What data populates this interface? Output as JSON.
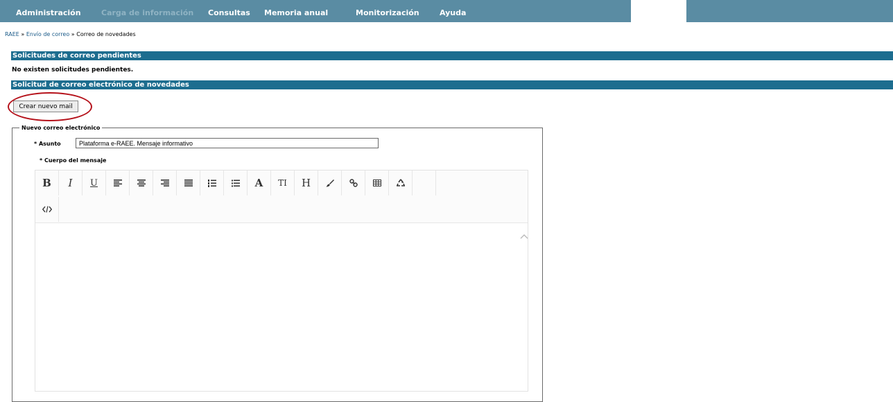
{
  "nav": {
    "items": [
      {
        "label": "Administración",
        "disabled": false
      },
      {
        "label": "Carga de información",
        "disabled": true
      },
      {
        "label": "Consultas",
        "disabled": false
      },
      {
        "label": "Memoria anual",
        "disabled": false
      },
      {
        "label": "Monitorización",
        "disabled": false
      },
      {
        "label": "Ayuda",
        "disabled": false
      }
    ]
  },
  "breadcrumb": {
    "root": "RAEE",
    "sep1": " » ",
    "parent": "Envío de correo",
    "sep2": " » ",
    "current": "Correo de novedades"
  },
  "pending": {
    "header": "Solicitudes de correo pendientes",
    "empty_text": "No existen solicitudes pendientes."
  },
  "request": {
    "header": "Solicitud de correo electrónico de novedades",
    "create_button": "Crear nuevo mail"
  },
  "form": {
    "legend": "Nuevo correo electrónico",
    "subject_label": "* Asunto",
    "subject_value": "Plataforma e-RAEE. Mensaje informativo",
    "body_label": "* Cuerpo del mensaje"
  },
  "editor": {
    "toolbar": [
      {
        "icon": "bold-icon",
        "glyph": "B"
      },
      {
        "icon": "italic-icon",
        "glyph": "I"
      },
      {
        "icon": "underline-icon",
        "glyph": "U"
      },
      {
        "icon": "align-left-icon",
        "glyph": ""
      },
      {
        "icon": "align-center-icon",
        "glyph": ""
      },
      {
        "icon": "align-right-icon",
        "glyph": ""
      },
      {
        "icon": "align-justify-icon",
        "glyph": ""
      },
      {
        "icon": "ordered-list-icon",
        "glyph": ""
      },
      {
        "icon": "unordered-list-icon",
        "glyph": ""
      },
      {
        "icon": "font-color-icon",
        "glyph": "A"
      },
      {
        "icon": "font-size-icon",
        "glyph": "TI"
      },
      {
        "icon": "heading-icon",
        "glyph": "H"
      },
      {
        "icon": "brush-icon",
        "glyph": ""
      },
      {
        "icon": "link-icon",
        "glyph": ""
      },
      {
        "icon": "table-icon",
        "glyph": ""
      },
      {
        "icon": "recycle-icon",
        "glyph": ""
      },
      {
        "icon": "code-view-icon",
        "glyph": ""
      }
    ]
  },
  "colors": {
    "nav_bg": "#5a8ca3",
    "section_bg": "#1d6d8f",
    "highlight": "#b5121b",
    "link": "#1a5a88"
  }
}
